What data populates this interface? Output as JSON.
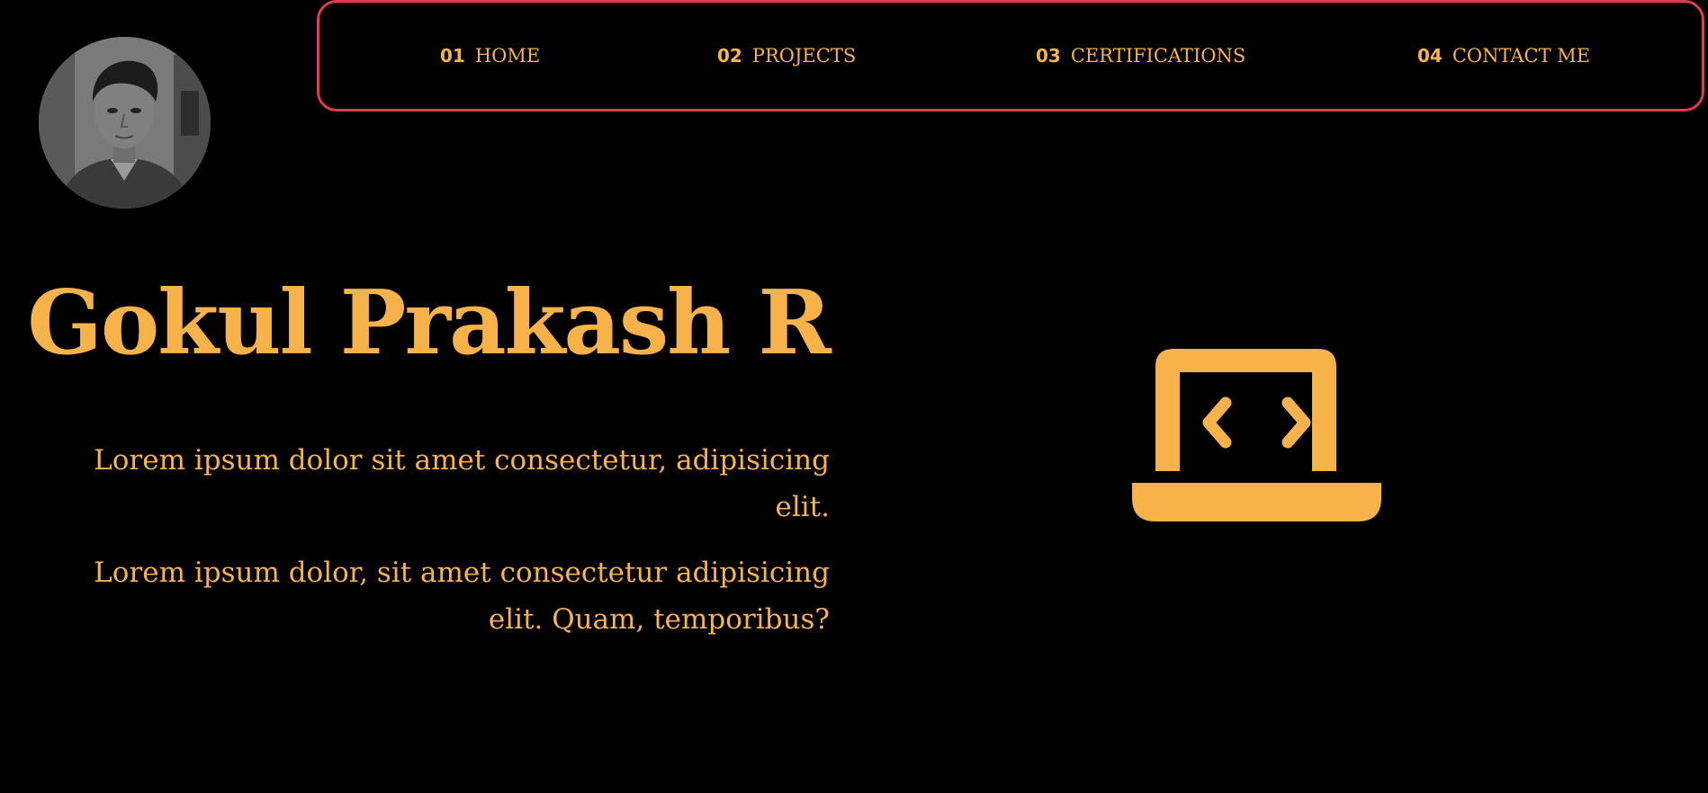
{
  "avatar": {
    "icon": "profile-photo"
  },
  "nav": {
    "items": [
      {
        "num": "01",
        "label": "HOME"
      },
      {
        "num": "02",
        "label": "PROJECTS"
      },
      {
        "num": "03",
        "label": "CERTIFICATIONS"
      },
      {
        "num": "04",
        "label": "CONTACT ME"
      }
    ]
  },
  "hero": {
    "title": "Gokul Prakash R",
    "paragraphs": [
      "Lorem ipsum dolor sit amet consectetur, adipisicing elit.",
      "Lorem ipsum dolor, sit amet consectetur adipisicing elit. Quam, temporibus?"
    ],
    "icon": "laptop-code-icon"
  },
  "colors": {
    "background": "#000000",
    "accent": "#f7b24a",
    "nav_border": "#e5394e"
  }
}
